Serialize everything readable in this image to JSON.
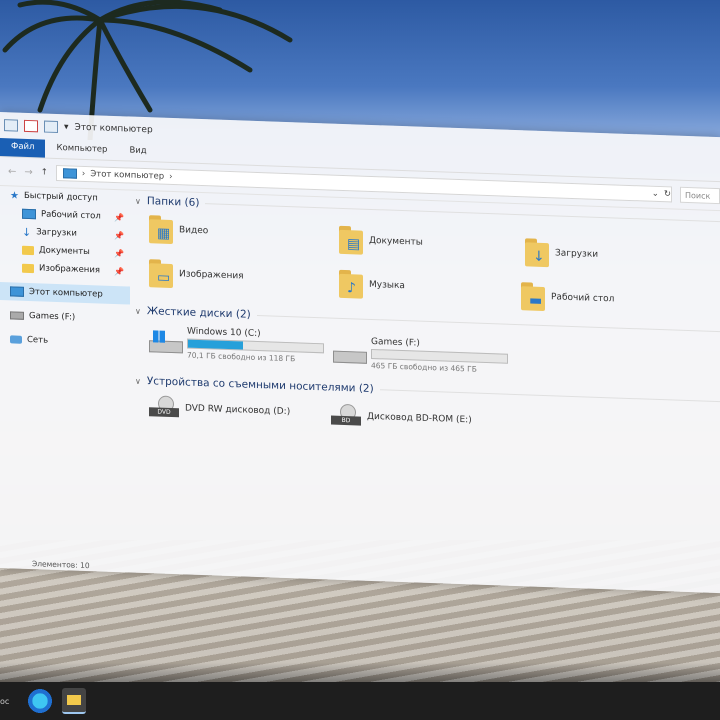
{
  "window": {
    "title": "Этот компьютер",
    "ribbon_tabs": [
      "Файл",
      "Компьютер",
      "Вид"
    ],
    "address_path": "Этот компьютер",
    "search_placeholder": "Поиск"
  },
  "sidebar": {
    "quick_access": "Быстрый доступ",
    "pinned": [
      {
        "label": "Рабочий стол"
      },
      {
        "label": "Загрузки"
      },
      {
        "label": "Документы"
      },
      {
        "label": "Изображения"
      }
    ],
    "this_pc": "Этот компьютер",
    "games": "Games (F:)",
    "network": "Сеть"
  },
  "main": {
    "folders_header": "Папки (6)",
    "folders": [
      {
        "label": "Видео",
        "icon": "video-folder-icon"
      },
      {
        "label": "Документы",
        "icon": "documents-folder-icon"
      },
      {
        "label": "Загрузки",
        "icon": "downloads-folder-icon"
      },
      {
        "label": "Изображения",
        "icon": "pictures-folder-icon"
      },
      {
        "label": "Музыка",
        "icon": "music-folder-icon"
      },
      {
        "label": "Рабочий стол",
        "icon": "desktop-folder-icon"
      }
    ],
    "drives_header": "Жесткие диски (2)",
    "drives": [
      {
        "label": "Windows 10 (C:)",
        "free_text": "70,1 ГБ свободно из 118 ГБ",
        "used_fraction": 0.41
      },
      {
        "label": "Games (F:)",
        "free_text": "465 ГБ свободно из 465 ГБ",
        "used_fraction": 0.0
      }
    ],
    "removable_header": "Устройства со съемными носителями (2)",
    "removable": [
      {
        "label": "DVD RW дисковод (D:)",
        "badge": "DVD"
      },
      {
        "label": "Дисковод BD-ROM (E:)",
        "badge": "BD"
      }
    ]
  },
  "status": "Элементов: 10",
  "taskbar": {
    "left_text": "ос"
  },
  "colors": {
    "accent": "#1a5fb4",
    "selection": "#cce4f7",
    "drive_fill": "#26a0da"
  }
}
